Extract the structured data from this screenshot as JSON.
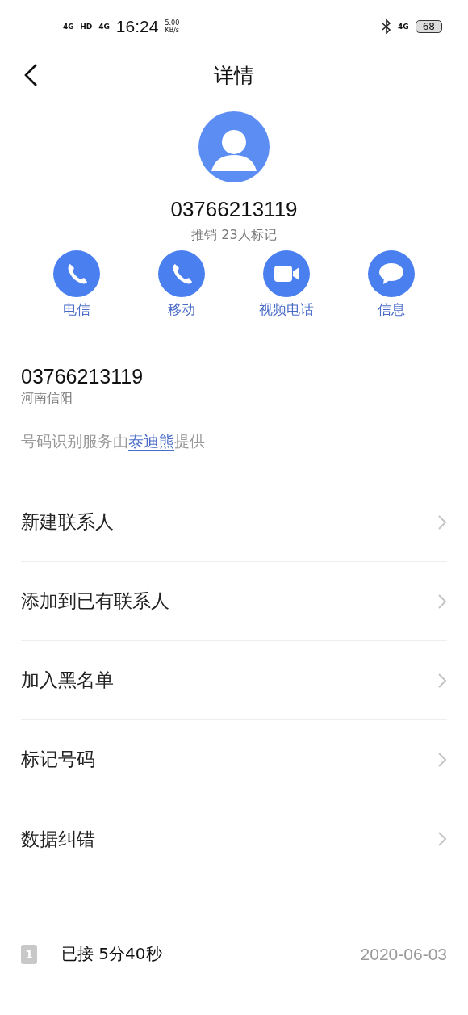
{
  "status_bar": {
    "signal_1": "4G+HD",
    "signal_2": "4G",
    "time": "16:24",
    "speed": "5.00",
    "speed_unit": "KB/s",
    "network": "4G",
    "battery": "68"
  },
  "header": {
    "title": "详情"
  },
  "contact": {
    "number": "03766213119",
    "tag": "推销 23人标记"
  },
  "actions": [
    {
      "kind": "phone",
      "label": "电信"
    },
    {
      "kind": "phone",
      "label": "移动"
    },
    {
      "kind": "video",
      "label": "视频电话"
    },
    {
      "kind": "message",
      "label": "信息"
    }
  ],
  "info": {
    "number": "03766213119",
    "location": "河南信阳",
    "provider_prefix": "号码识别服务由",
    "provider_link": "泰迪熊",
    "provider_suffix": "提供"
  },
  "menu": [
    {
      "label": "新建联系人"
    },
    {
      "label": "添加到已有联系人"
    },
    {
      "label": "加入黑名单"
    },
    {
      "label": "标记号码"
    },
    {
      "label": "数据纠错"
    }
  ],
  "call_log": [
    {
      "sim": "1",
      "result": "已接 5分40秒",
      "date": "2020-06-03"
    }
  ]
}
